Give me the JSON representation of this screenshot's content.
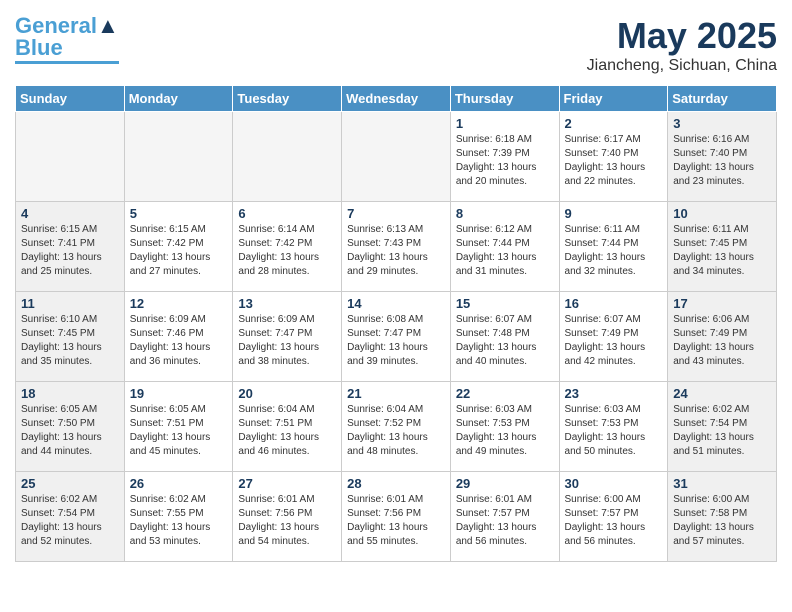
{
  "header": {
    "logo_line1": "General",
    "logo_line2": "Blue",
    "month": "May 2025",
    "location": "Jiancheng, Sichuan, China"
  },
  "weekdays": [
    "Sunday",
    "Monday",
    "Tuesday",
    "Wednesday",
    "Thursday",
    "Friday",
    "Saturday"
  ],
  "weeks": [
    [
      {
        "day": "",
        "info": "",
        "empty": true
      },
      {
        "day": "",
        "info": "",
        "empty": true
      },
      {
        "day": "",
        "info": "",
        "empty": true
      },
      {
        "day": "",
        "info": "",
        "empty": true
      },
      {
        "day": "1",
        "info": "Sunrise: 6:18 AM\nSunset: 7:39 PM\nDaylight: 13 hours and 20 minutes.",
        "empty": false
      },
      {
        "day": "2",
        "info": "Sunrise: 6:17 AM\nSunset: 7:40 PM\nDaylight: 13 hours and 22 minutes.",
        "empty": false
      },
      {
        "day": "3",
        "info": "Sunrise: 6:16 AM\nSunset: 7:40 PM\nDaylight: 13 hours and 23 minutes.",
        "empty": false
      }
    ],
    [
      {
        "day": "4",
        "info": "Sunrise: 6:15 AM\nSunset: 7:41 PM\nDaylight: 13 hours and 25 minutes.",
        "empty": false
      },
      {
        "day": "5",
        "info": "Sunrise: 6:15 AM\nSunset: 7:42 PM\nDaylight: 13 hours and 27 minutes.",
        "empty": false
      },
      {
        "day": "6",
        "info": "Sunrise: 6:14 AM\nSunset: 7:42 PM\nDaylight: 13 hours and 28 minutes.",
        "empty": false
      },
      {
        "day": "7",
        "info": "Sunrise: 6:13 AM\nSunset: 7:43 PM\nDaylight: 13 hours and 29 minutes.",
        "empty": false
      },
      {
        "day": "8",
        "info": "Sunrise: 6:12 AM\nSunset: 7:44 PM\nDaylight: 13 hours and 31 minutes.",
        "empty": false
      },
      {
        "day": "9",
        "info": "Sunrise: 6:11 AM\nSunset: 7:44 PM\nDaylight: 13 hours and 32 minutes.",
        "empty": false
      },
      {
        "day": "10",
        "info": "Sunrise: 6:11 AM\nSunset: 7:45 PM\nDaylight: 13 hours and 34 minutes.",
        "empty": false
      }
    ],
    [
      {
        "day": "11",
        "info": "Sunrise: 6:10 AM\nSunset: 7:45 PM\nDaylight: 13 hours and 35 minutes.",
        "empty": false
      },
      {
        "day": "12",
        "info": "Sunrise: 6:09 AM\nSunset: 7:46 PM\nDaylight: 13 hours and 36 minutes.",
        "empty": false
      },
      {
        "day": "13",
        "info": "Sunrise: 6:09 AM\nSunset: 7:47 PM\nDaylight: 13 hours and 38 minutes.",
        "empty": false
      },
      {
        "day": "14",
        "info": "Sunrise: 6:08 AM\nSunset: 7:47 PM\nDaylight: 13 hours and 39 minutes.",
        "empty": false
      },
      {
        "day": "15",
        "info": "Sunrise: 6:07 AM\nSunset: 7:48 PM\nDaylight: 13 hours and 40 minutes.",
        "empty": false
      },
      {
        "day": "16",
        "info": "Sunrise: 6:07 AM\nSunset: 7:49 PM\nDaylight: 13 hours and 42 minutes.",
        "empty": false
      },
      {
        "day": "17",
        "info": "Sunrise: 6:06 AM\nSunset: 7:49 PM\nDaylight: 13 hours and 43 minutes.",
        "empty": false
      }
    ],
    [
      {
        "day": "18",
        "info": "Sunrise: 6:05 AM\nSunset: 7:50 PM\nDaylight: 13 hours and 44 minutes.",
        "empty": false
      },
      {
        "day": "19",
        "info": "Sunrise: 6:05 AM\nSunset: 7:51 PM\nDaylight: 13 hours and 45 minutes.",
        "empty": false
      },
      {
        "day": "20",
        "info": "Sunrise: 6:04 AM\nSunset: 7:51 PM\nDaylight: 13 hours and 46 minutes.",
        "empty": false
      },
      {
        "day": "21",
        "info": "Sunrise: 6:04 AM\nSunset: 7:52 PM\nDaylight: 13 hours and 48 minutes.",
        "empty": false
      },
      {
        "day": "22",
        "info": "Sunrise: 6:03 AM\nSunset: 7:53 PM\nDaylight: 13 hours and 49 minutes.",
        "empty": false
      },
      {
        "day": "23",
        "info": "Sunrise: 6:03 AM\nSunset: 7:53 PM\nDaylight: 13 hours and 50 minutes.",
        "empty": false
      },
      {
        "day": "24",
        "info": "Sunrise: 6:02 AM\nSunset: 7:54 PM\nDaylight: 13 hours and 51 minutes.",
        "empty": false
      }
    ],
    [
      {
        "day": "25",
        "info": "Sunrise: 6:02 AM\nSunset: 7:54 PM\nDaylight: 13 hours and 52 minutes.",
        "empty": false
      },
      {
        "day": "26",
        "info": "Sunrise: 6:02 AM\nSunset: 7:55 PM\nDaylight: 13 hours and 53 minutes.",
        "empty": false
      },
      {
        "day": "27",
        "info": "Sunrise: 6:01 AM\nSunset: 7:56 PM\nDaylight: 13 hours and 54 minutes.",
        "empty": false
      },
      {
        "day": "28",
        "info": "Sunrise: 6:01 AM\nSunset: 7:56 PM\nDaylight: 13 hours and 55 minutes.",
        "empty": false
      },
      {
        "day": "29",
        "info": "Sunrise: 6:01 AM\nSunset: 7:57 PM\nDaylight: 13 hours and 56 minutes.",
        "empty": false
      },
      {
        "day": "30",
        "info": "Sunrise: 6:00 AM\nSunset: 7:57 PM\nDaylight: 13 hours and 56 minutes.",
        "empty": false
      },
      {
        "day": "31",
        "info": "Sunrise: 6:00 AM\nSunset: 7:58 PM\nDaylight: 13 hours and 57 minutes.",
        "empty": false
      }
    ]
  ]
}
